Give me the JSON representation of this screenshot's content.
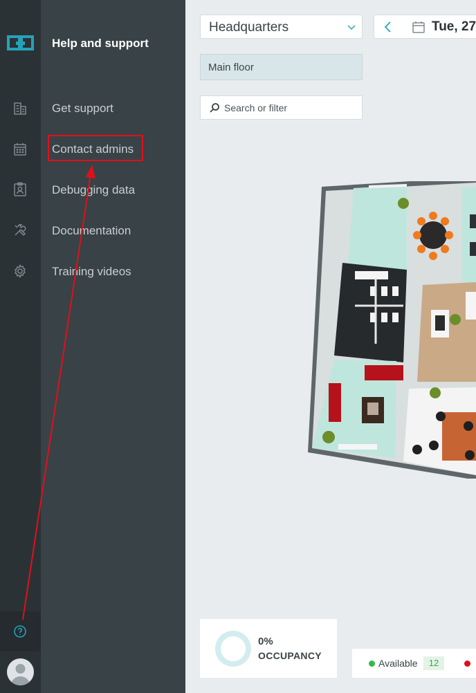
{
  "sidebar": {
    "logo_icon": "linked-squares-logo",
    "nav_icons": [
      "building-icon",
      "calendar-icon",
      "badge-icon",
      "tools-icon",
      "gear-icon"
    ],
    "help_icon": "question-circle-icon",
    "avatar_icon": "user-avatar-icon",
    "active_color": "#24a3b8"
  },
  "help_panel": {
    "title": "Help and support",
    "items": [
      {
        "label": "Get support"
      },
      {
        "label": "Contact admins"
      },
      {
        "label": "Debugging data"
      },
      {
        "label": "Documentation"
      },
      {
        "label": "Training videos"
      }
    ],
    "collapse_icon": "collapse-left-icon"
  },
  "header": {
    "location_value": "Headquarters",
    "date_value": "Tue, 27",
    "floor_tab": "Main floor",
    "search_placeholder": "Search or filter"
  },
  "stats": {
    "occupancy_value": "0%",
    "occupancy_label": "OCCUPANCY",
    "legend_available_label": "Available",
    "legend_available_count": "12",
    "available_color": "#35b84a",
    "occupied_color": "#e0101b"
  },
  "annotation": {
    "highlight_color": "#e0101b"
  }
}
